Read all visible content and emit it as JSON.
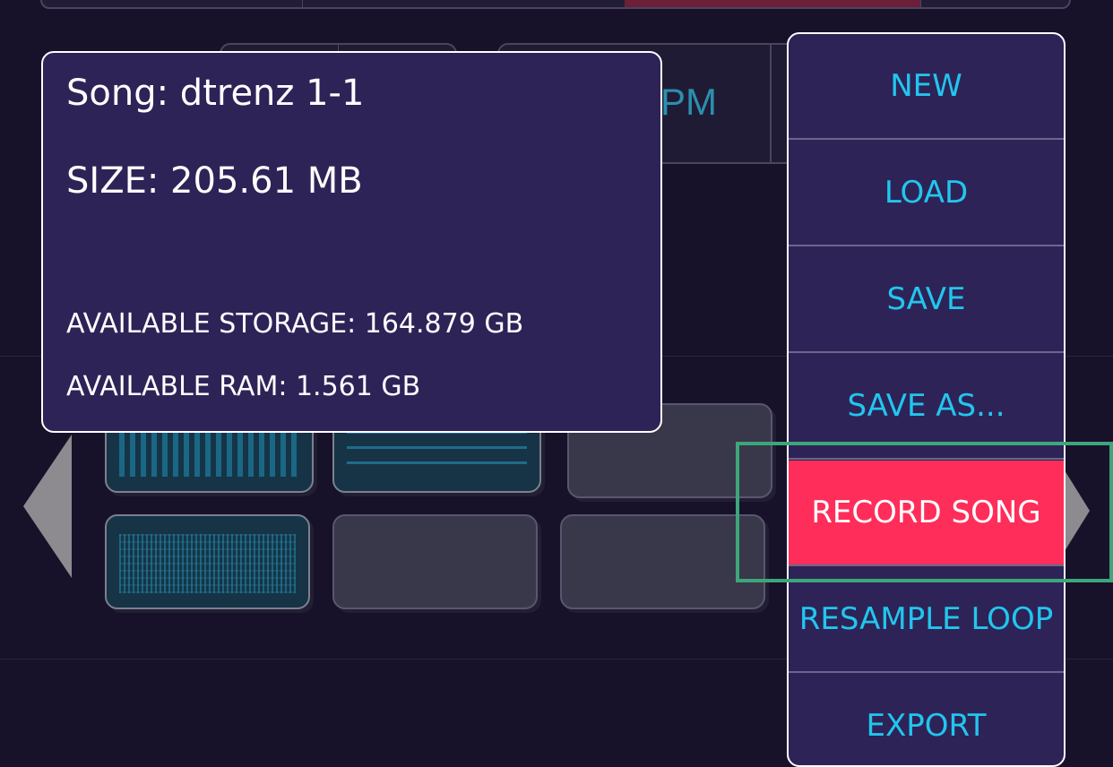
{
  "background": {
    "partial_label": "PM"
  },
  "info_panel": {
    "song": "Song: dtrenz 1-1",
    "size": "SIZE: 205.61 MB",
    "storage": "AVAILABLE STORAGE: 164.879 GB",
    "ram": "AVAILABLE RAM: 1.561 GB"
  },
  "menu": {
    "items": [
      {
        "label": "NEW"
      },
      {
        "label": "LOAD"
      },
      {
        "label": "SAVE"
      },
      {
        "label": "SAVE AS..."
      },
      {
        "label": "RECORD SONG",
        "active": true
      },
      {
        "label": "RESAMPLE LOOP"
      },
      {
        "label": "EXPORT"
      }
    ]
  },
  "colors": {
    "background": "#17122a",
    "panel": "#2e2357",
    "menu_text": "#21c6ee",
    "active_item": "#ff2d5a",
    "highlight_box": "#3da67a"
  }
}
